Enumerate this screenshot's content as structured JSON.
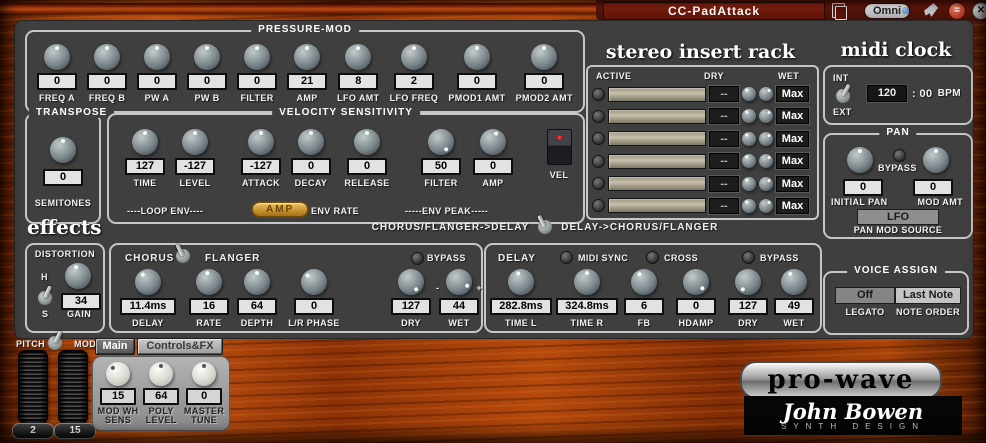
{
  "window": {
    "patch_name": "CC-PadAttack",
    "omni_label": "Omni",
    "close_glyph": "✕",
    "minimize_glyph": "="
  },
  "pressure_mod": {
    "title": "PRESSURE-MOD",
    "knobs": [
      {
        "label": "FREQ A",
        "value": "0"
      },
      {
        "label": "FREQ B",
        "value": "0"
      },
      {
        "label": "PW A",
        "value": "0"
      },
      {
        "label": "PW B",
        "value": "0"
      },
      {
        "label": "FILTER",
        "value": "0"
      },
      {
        "label": "AMP",
        "value": "21"
      },
      {
        "label": "LFO AMT",
        "value": "8"
      },
      {
        "label": "LFO FREQ",
        "value": "2"
      },
      {
        "label": "PMOD1 AMT",
        "value": "0"
      },
      {
        "label": "PMOD2 AMT",
        "value": "0"
      }
    ]
  },
  "transpose": {
    "title": "TRANSPOSE",
    "value": "0",
    "label": "SEMITONES"
  },
  "velocity": {
    "title": "VELOCITY SENSITIVITY",
    "knobs": [
      {
        "label": "TIME",
        "value": "127"
      },
      {
        "label": "LEVEL",
        "value": "-127"
      },
      {
        "label": "ATTACK",
        "value": "-127"
      },
      {
        "label": "DECAY",
        "value": "0"
      },
      {
        "label": "RELEASE",
        "value": "0"
      },
      {
        "label": "FILTER",
        "value": "50"
      },
      {
        "label": "AMP",
        "value": "0"
      }
    ],
    "vel_label": "VEL",
    "loop_env": "----LOOP ENV----",
    "amp_button": "AMP",
    "env_rate": "ENV RATE",
    "env_peak": "-----ENV PEAK-----"
  },
  "rack": {
    "title": "stereo insert rack",
    "headers": {
      "active": "ACTIVE",
      "dry": "DRY",
      "wet": "WET"
    },
    "rows": [
      {
        "dry": "--",
        "wet": "Max"
      },
      {
        "dry": "--",
        "wet": "Max"
      },
      {
        "dry": "--",
        "wet": "Max"
      },
      {
        "dry": "--",
        "wet": "Max"
      },
      {
        "dry": "--",
        "wet": "Max"
      },
      {
        "dry": "--",
        "wet": "Max"
      }
    ]
  },
  "midi_clock": {
    "title": "midi clock",
    "int_label": "INT",
    "ext_label": "EXT",
    "bpm_value": "120",
    "bpm_rest": ": 00",
    "bpm_unit": "BPM"
  },
  "pan": {
    "title": "PAN",
    "bypass_label": "BYPASS",
    "initial": {
      "label": "INITIAL PAN",
      "value": "0"
    },
    "mod": {
      "label": "MOD AMT",
      "value": "0"
    },
    "source_value": "LFO",
    "source_label": "PAN MOD SOURCE"
  },
  "effects_title": "effects",
  "routing": {
    "left": "CHORUS/FLANGER->DELAY",
    "right": "DELAY->CHORUS/FLANGER"
  },
  "distortion": {
    "title": "DISTORTION",
    "h_label": "H",
    "s_label": "S",
    "value": "34",
    "label": "GAIN"
  },
  "chorus": {
    "title_left": "CHORUS",
    "title_right": "FLANGER",
    "bypass_label": "BYPASS",
    "wet_minus": "-",
    "wet_plus": "+",
    "knobs": [
      {
        "label": "DELAY",
        "value": "11.4ms"
      },
      {
        "label": "RATE",
        "value": "16"
      },
      {
        "label": "DEPTH",
        "value": "64"
      },
      {
        "label": "L/R PHASE",
        "value": "0"
      },
      {
        "label": "DRY",
        "value": "127"
      },
      {
        "label": "WET",
        "value": "44"
      }
    ]
  },
  "delay_fx": {
    "title": "DELAY",
    "midi_sync_label": "MIDI SYNC",
    "cross_label": "CROSS",
    "bypass_label": "BYPASS",
    "knobs": [
      {
        "label": "TIME L",
        "value": "282.8ms"
      },
      {
        "label": "TIME R",
        "value": "324.8ms"
      },
      {
        "label": "FB",
        "value": "6"
      },
      {
        "label": "HDAMP",
        "value": "0"
      },
      {
        "label": "DRY",
        "value": "127"
      },
      {
        "label": "WET",
        "value": "49"
      }
    ]
  },
  "voice_assign": {
    "title": "VOICE ASSIGN",
    "legato_value": "Off",
    "legato_label": "LEGATO",
    "order_value": "Last Note",
    "order_label": "NOTE ORDER"
  },
  "bottom": {
    "pitch_label": "PITCH",
    "mod_label": "MOD",
    "pitch_range": "2",
    "mod_range": "15",
    "tabs": [
      {
        "label": "Main"
      },
      {
        "label": "Controls&FX"
      }
    ],
    "knobs": [
      {
        "label1": "MOD WH",
        "label2": "SENS",
        "value": "15"
      },
      {
        "label1": "POLY",
        "label2": "LEVEL",
        "value": "64"
      },
      {
        "label1": "MASTER",
        "label2": "TUNE",
        "value": "0"
      }
    ]
  },
  "logo": {
    "name": "pro-wave",
    "brand": "John Bowen",
    "sub": "SYNTH DESIGN"
  },
  "colors": {
    "panel": "#3f3f3f",
    "wood": "#b54a0c",
    "titlebar": "#5a150a",
    "amp_button_gold": "#d09a30",
    "led_blue": "#5588cc"
  }
}
